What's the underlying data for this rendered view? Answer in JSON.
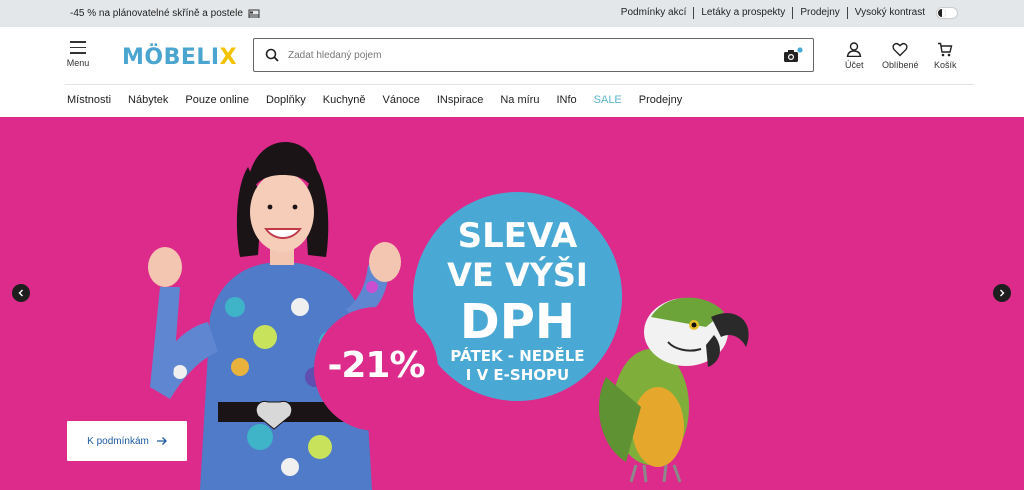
{
  "topbar": {
    "promo_text": "-45 % na plánovatelné skříně a postele",
    "promo_icon": "bed-icon",
    "links": [
      "Podmínky akcí",
      "Letáky a prospekty",
      "Prodejny"
    ],
    "contrast_label": "Vysoký kontrast"
  },
  "header": {
    "menu_label": "Menu",
    "logo_main": "MÖBELI",
    "logo_accent": "X",
    "search_placeholder": "Zadat hledaný pojem",
    "account_label": "Účet",
    "favorites_label": "Oblíbené",
    "cart_label": "Košík"
  },
  "nav": {
    "items": [
      "Místnosti",
      "Nábytek",
      "Pouze online",
      "Doplňky",
      "Kuchyně",
      "Vánoce",
      "INspirace",
      "Na míru",
      "INfo",
      "SALE",
      "Prodejny"
    ]
  },
  "hero": {
    "headline_1": "SLEVA",
    "headline_2": "VE VÝŠI",
    "headline_3": "DPH",
    "subline_1": "PÁTEK - NEDĚLE",
    "subline_2": "I V E-SHOPU",
    "discount": "-21%",
    "cta_label": "K podmínkám",
    "background_color": "#dc2b8b",
    "circle_color": "#4aa9d4"
  },
  "colors": {
    "brand_blue": "#4aa6d0",
    "brand_yellow": "#f3c200",
    "sale": "#5bb5c9",
    "cta_text": "#1d5aa3"
  }
}
